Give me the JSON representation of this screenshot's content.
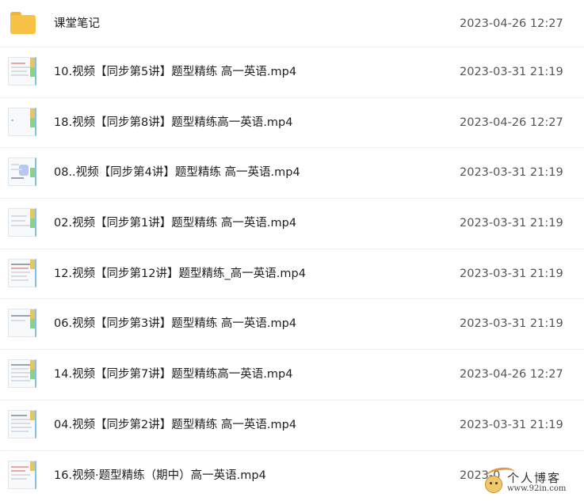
{
  "files": [
    {
      "type": "folder",
      "name": "课堂笔记",
      "date": "2023-04-26 12:27",
      "icon": "folder-icon"
    },
    {
      "type": "video",
      "name": "10.视频【同步第5讲】题型精练 高一英语.mp4",
      "date": "2023-03-31 21:19",
      "icon": "video-thumbnail-icon"
    },
    {
      "type": "video",
      "name": "18.视频【同步第8讲】题型精练高一英语.mp4",
      "date": "2023-04-26 12:27",
      "icon": "video-thumbnail-icon"
    },
    {
      "type": "video",
      "name": "08..视频【同步第4讲】题型精练 高一英语.mp4",
      "date": "2023-03-31 21:19",
      "icon": "video-thumbnail-icon"
    },
    {
      "type": "video",
      "name": "02.视频【同步第1讲】题型精练 高一英语.mp4",
      "date": "2023-03-31 21:19",
      "icon": "video-thumbnail-icon"
    },
    {
      "type": "video",
      "name": "12.视频【同步第12讲】题型精练_高一英语.mp4",
      "date": "2023-03-31 21:19",
      "icon": "video-thumbnail-icon"
    },
    {
      "type": "video",
      "name": "06.视频【同步第3讲】题型精练 高一英语.mp4",
      "date": "2023-03-31 21:19",
      "icon": "video-thumbnail-icon"
    },
    {
      "type": "video",
      "name": "14.视频【同步第7讲】题型精练高一英语.mp4",
      "date": "2023-04-26 12:27",
      "icon": "video-thumbnail-icon"
    },
    {
      "type": "video",
      "name": "04.视频【同步第2讲】题型精练 高一英语.mp4",
      "date": "2023-03-31 21:19",
      "icon": "video-thumbnail-icon"
    },
    {
      "type": "video",
      "name": "16.视频·题型精练（期中）高一英语.mp4",
      "date": "2023-0",
      "icon": "video-thumbnail-icon"
    }
  ],
  "watermark": {
    "title": "个人博客",
    "url": "www.92in.com"
  },
  "colors": {
    "folder": "#f7c245",
    "date_text": "#555555",
    "name_text": "#202020",
    "divider": "#eeeeee"
  }
}
